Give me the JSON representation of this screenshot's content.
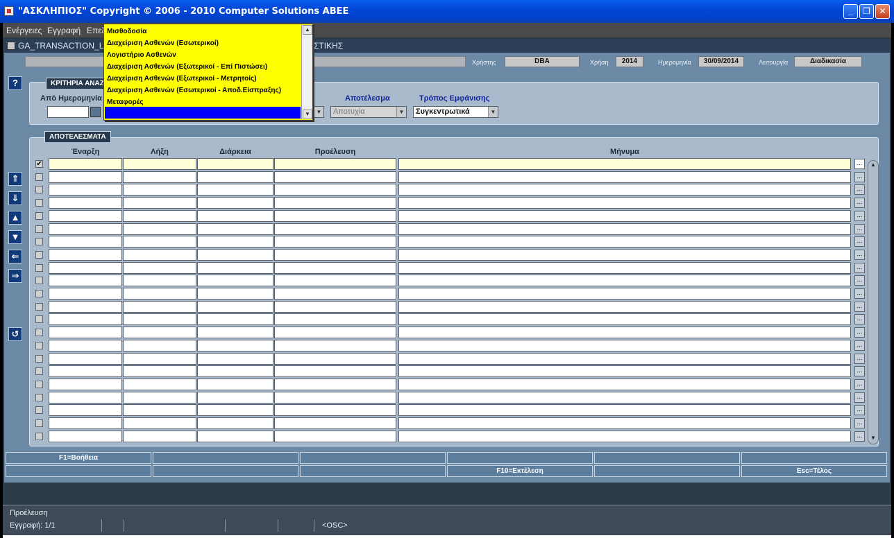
{
  "window": {
    "title": "\"ΑΣΚΛΗΠΙΟΣ\" Copyright © 2006 - 2010 Computer Solutions ABEE"
  },
  "menu": {
    "items": [
      "Ενέργειες",
      "Εγγραφή",
      "Επεξ"
    ]
  },
  "form": {
    "title": "GA_TRANSACTION_L",
    "title_tail": "ΣΤΙΚΗΣ"
  },
  "info": {
    "user_label": "Χρήστης",
    "user_value": "DBA",
    "year_label": "Χρήση",
    "year_value": "2014",
    "date_label": "Ημερομηνία",
    "date_value": "30/09/2014",
    "func_label": "Λειτουργία",
    "func_value": "Διαδικασία"
  },
  "criteria": {
    "tab": "ΚΡΙΤΗΡΙΑ ΑΝΑΖ",
    "from_date_label": "Από Ημερομηνία",
    "result_label": "Αποτέλεσμα",
    "result_value": "Αποτυχία",
    "display_label": "Τρόπος Εμφάνισης",
    "display_value": "Συγκεντρωτικά"
  },
  "results": {
    "tab": "ΑΠΟΤΕΛΕΣΜΑΤΑ",
    "columns": [
      "Έναρξη",
      "Λήξη",
      "Διάρκεια",
      "Προέλευση",
      "Μήνυμα"
    ],
    "ellipsis": "...",
    "checkmark": "✔"
  },
  "dropdown": {
    "options": [
      "Μισθοδοσία",
      "Διαχείριση Ασθενών (Εσωτερικοί)",
      "Λογιστήριο Ασθενών",
      "Διαχείριση Ασθενών (Εξωτερικοί - Επί Πιστώσει)",
      "Διαχείριση Ασθενών (Εξωτερικοί - Μετρητοίς)",
      "Διαχείριση Ασθενών (Εσωτερικοί - Αποδ.Είσπραξης)",
      "Μεταφορές"
    ]
  },
  "fkeys": {
    "row1": [
      "F1=Βοήθεια",
      "",
      "",
      "",
      "",
      ""
    ],
    "row2": [
      "",
      "",
      "",
      "F10=Εκτέλεση",
      "",
      "Esc=Τέλος"
    ]
  },
  "status": {
    "field": "Προέλευση",
    "record": "Εγγραφή: 1/1",
    "osc": "<OSC>"
  },
  "icons": {
    "help": "help-icon",
    "nav": [
      "first-record-icon",
      "last-record-icon",
      "prev-record-icon",
      "next-record-icon",
      "prev-block-icon",
      "next-block-icon"
    ],
    "exit": "return-icon"
  }
}
